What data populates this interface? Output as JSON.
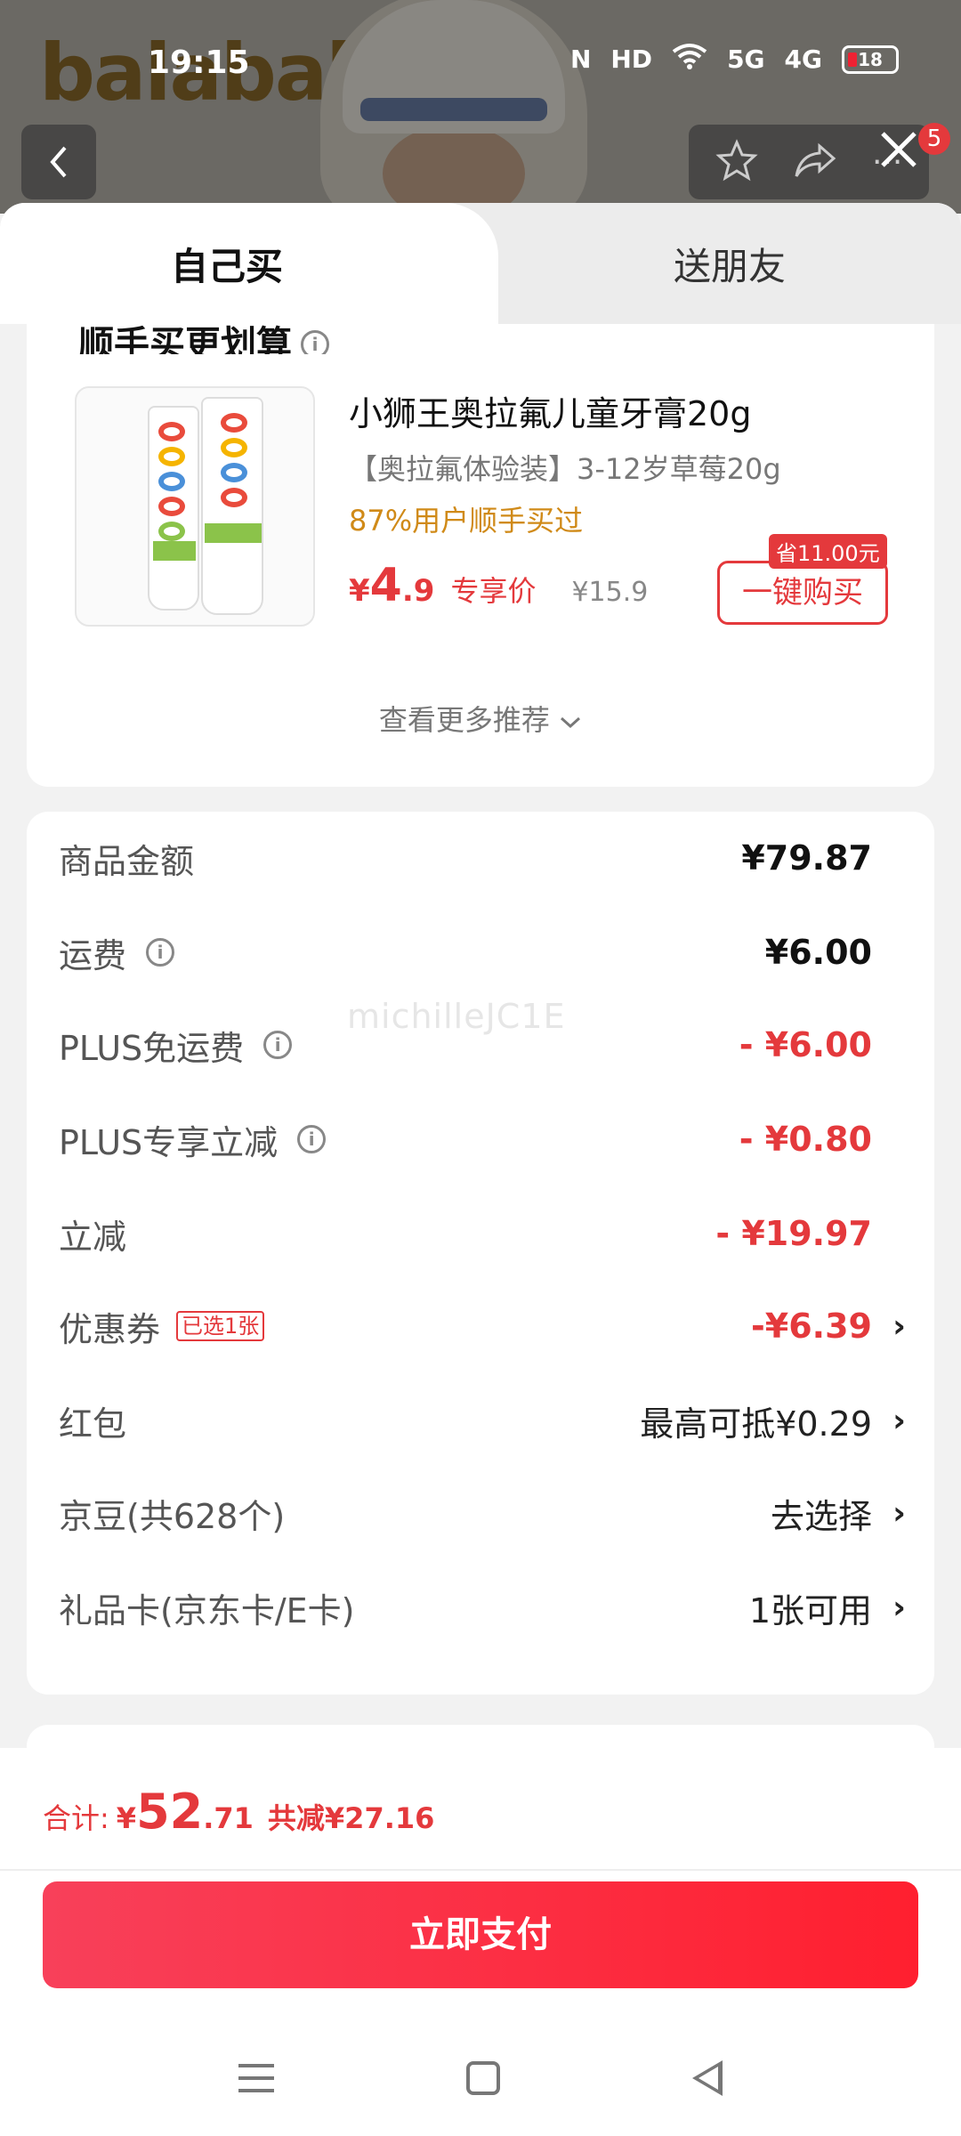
{
  "status_bar": {
    "time": "19:15",
    "icons": [
      "nfc-icon",
      "hd-icon",
      "wifi-icon",
      "5g-signal-icon",
      "4g-signal-icon",
      "battery-icon"
    ],
    "network_5g": "5G",
    "network_4g": "4G",
    "hd": "HD",
    "battery": "18"
  },
  "background": {
    "brand": "balabala",
    "nav_badge": "5"
  },
  "tabs": {
    "self": "自己买",
    "gift": "送朋友"
  },
  "recommend": {
    "title": "顺手买更划算",
    "product_title": "小狮王奥拉氟儿童牙膏20g",
    "product_spec": "【奥拉氟体验装】3-12岁草莓20g",
    "social_proof": "87%用户顺手买过",
    "price_symbol": "¥",
    "price_int": "4",
    "price_dec": ".9",
    "price_tag": "专享价",
    "original_price": "¥15.9",
    "save_badge": "省11.00元",
    "buy_button": "一键购买",
    "more_link": "查看更多推荐"
  },
  "fees": {
    "goods_label": "商品金额",
    "goods_value": "¥79.87",
    "shipping_label": "运费",
    "shipping_value": "¥6.00",
    "plus_free_label": "PLUS免运费",
    "plus_free_value": "- ¥6.00",
    "plus_discount_label": "PLUS专享立减",
    "plus_discount_value": "- ¥0.80",
    "discount_label": "立减",
    "discount_value": "- ¥19.97",
    "coupon_label": "优惠券",
    "coupon_tag": "已选1张",
    "coupon_value": "-¥6.39",
    "redpacket_label": "红包",
    "redpacket_value": "最高可抵¥0.29",
    "jingdou_label": "京豆(共628个)",
    "jingdou_value": "去选择",
    "giftcard_label": "礼品卡(京东卡/E卡)",
    "giftcard_value": "1张可用"
  },
  "watermark": "michilleJC1E",
  "footer": {
    "total_label": "合计:",
    "total_symbol": "¥",
    "total_int": "52",
    "total_dec": ".71",
    "total_saved": "共减¥27.16",
    "pay_button": "立即支付"
  },
  "colors": {
    "accent_red": "#e4393c",
    "social_orange": "#d08a18",
    "pay_gradient_start": "#f8405a",
    "pay_gradient_end": "#ff1f2f"
  }
}
